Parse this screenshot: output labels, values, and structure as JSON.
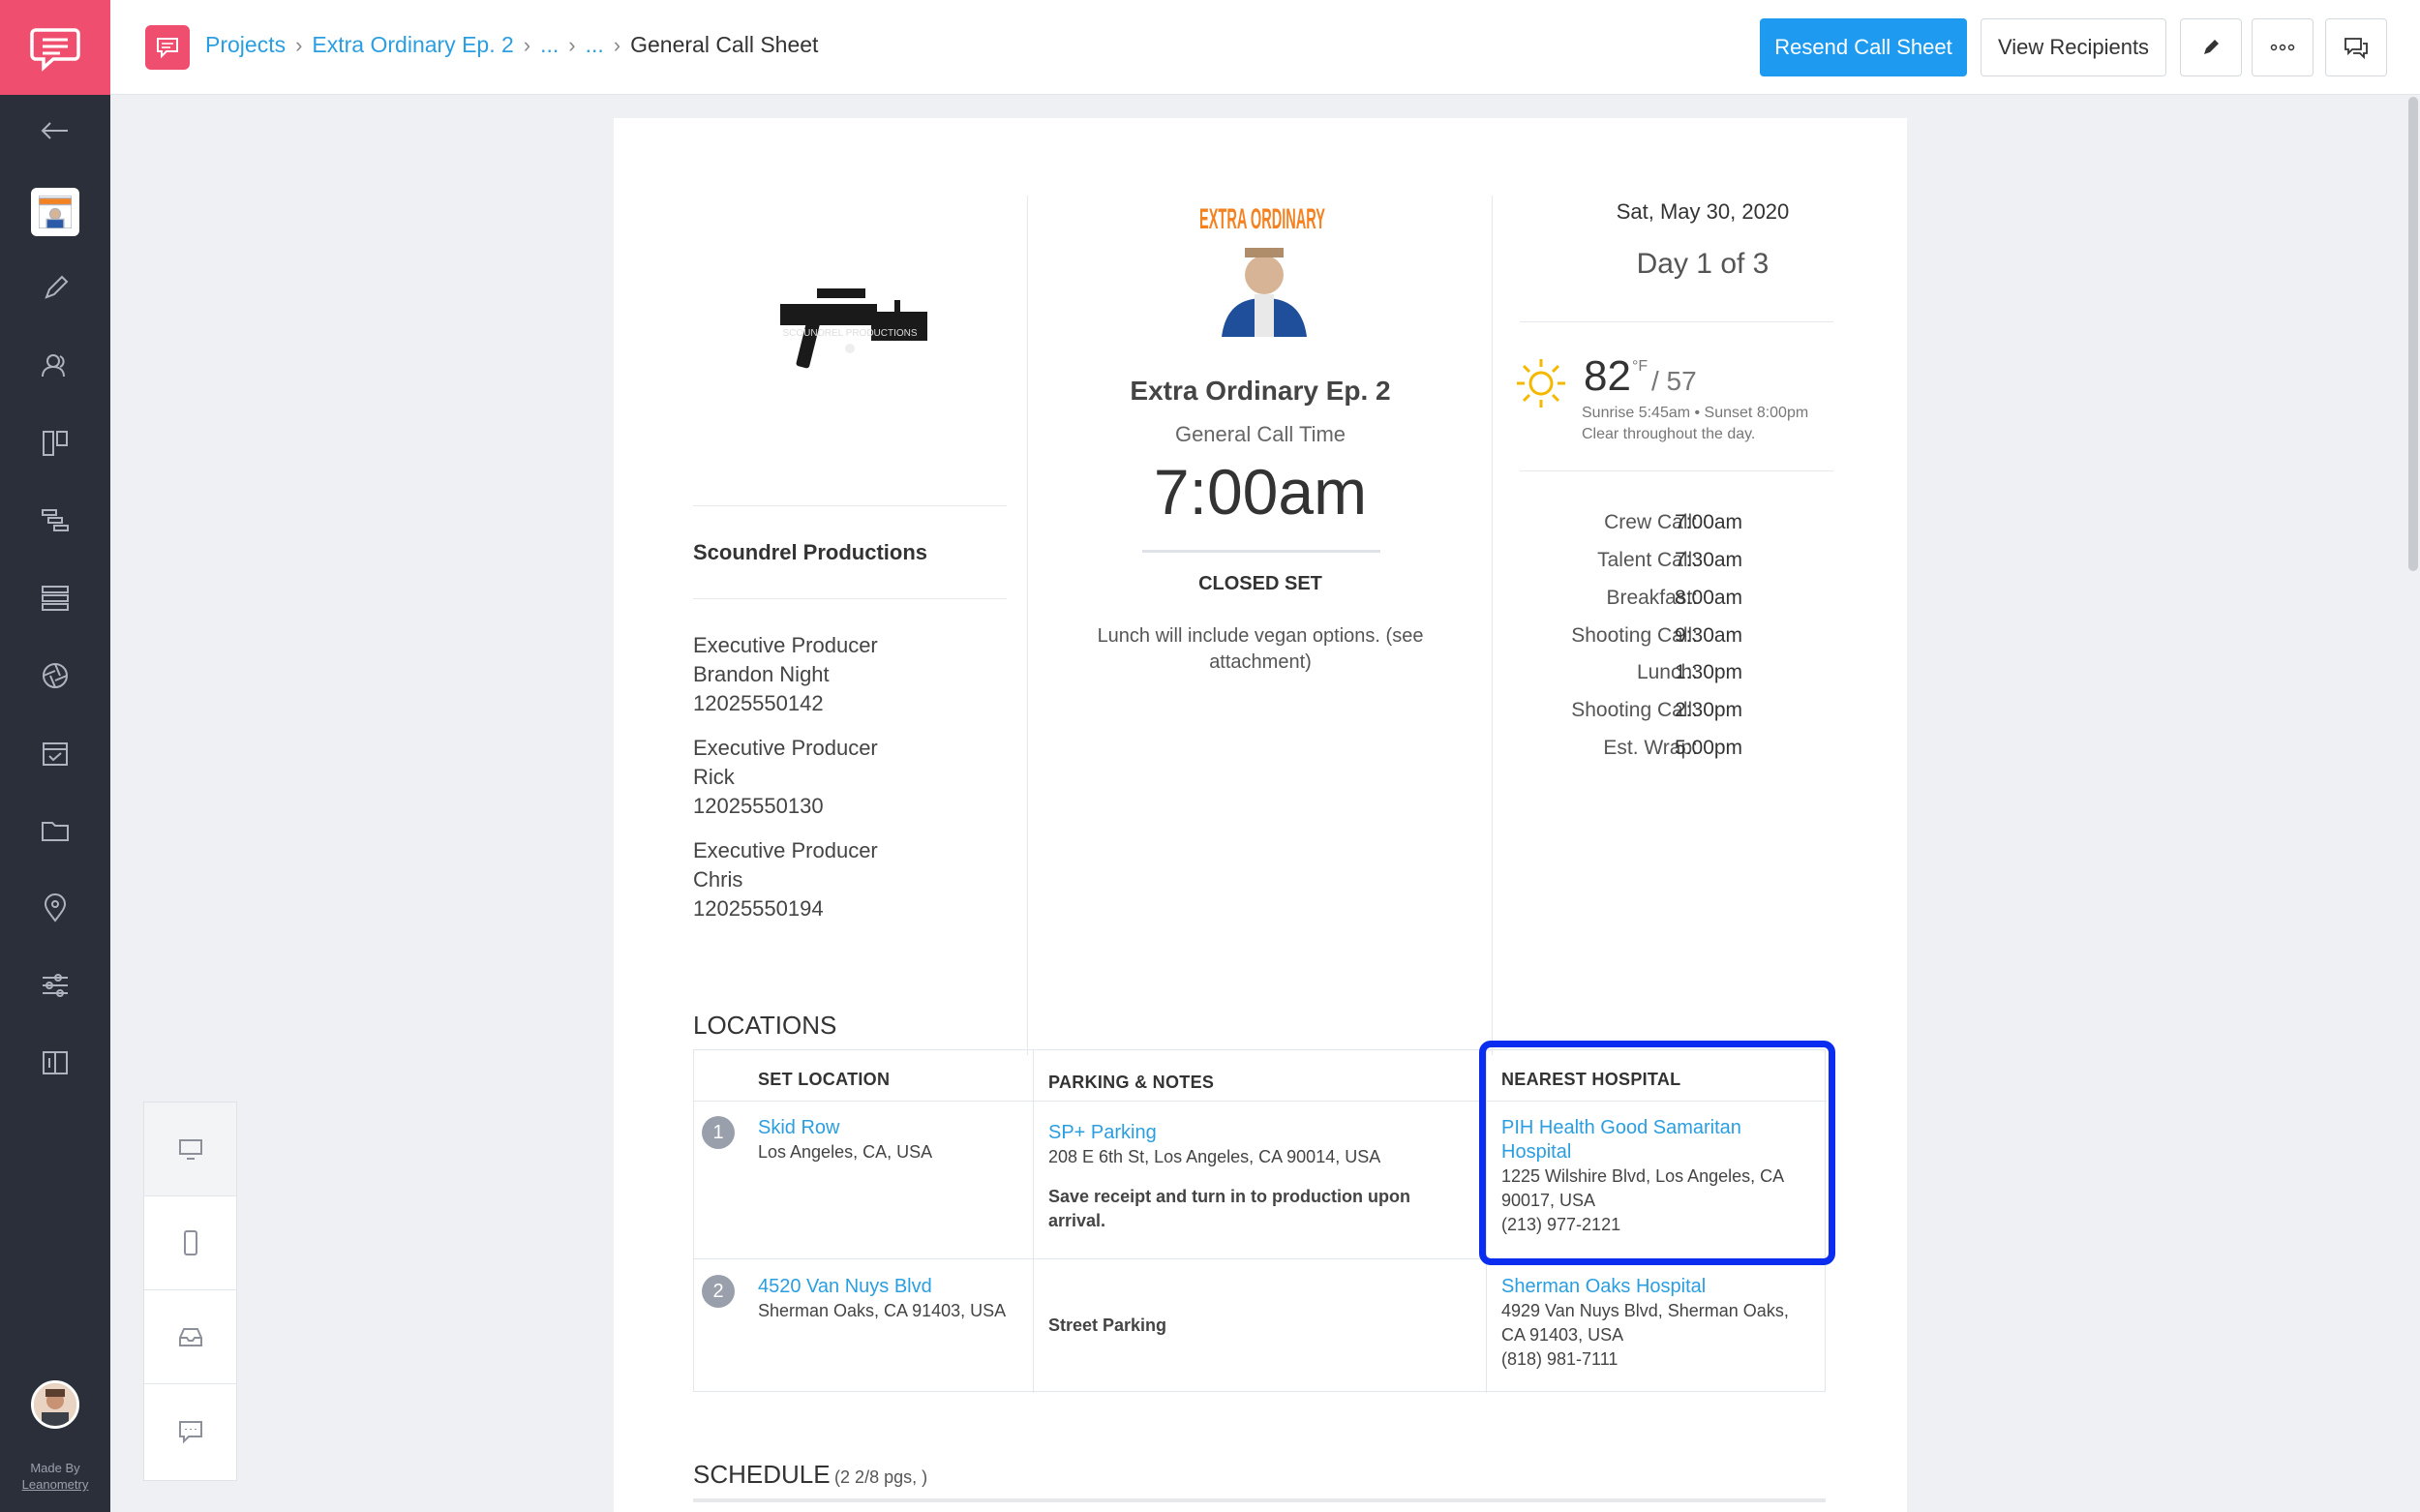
{
  "topbar": {
    "breadcrumb": [
      "Projects",
      "Extra Ordinary Ep. 2",
      "...",
      "...",
      "General Call Sheet"
    ],
    "resend_label": "Resend Call Sheet",
    "view_recipients_label": "View Recipients",
    "edit_icon": "pencil-icon",
    "more_icon": "ellipsis-icon",
    "comments_icon": "chat-bubbles-icon"
  },
  "sidebar": {
    "items": [
      "back-arrow-icon",
      "project-thumbnail",
      "pencil-icon",
      "people-icon",
      "board-icon",
      "gantt-icon",
      "stripboard-icon",
      "aperture-icon",
      "calendar-check-icon",
      "folder-icon",
      "location-pin-icon",
      "sliders-icon",
      "book-icon"
    ],
    "made_by": "Made By",
    "made_by_company": "Leanometry"
  },
  "device_panel": [
    "desktop-icon",
    "mobile-icon",
    "inbox-icon",
    "message-icon"
  ],
  "sheet": {
    "company": "Scoundrel Productions",
    "contacts": [
      {
        "role": "Executive Producer",
        "name": "Brandon Night",
        "phone": "12025550142"
      },
      {
        "role": "Executive Producer",
        "name": "Rick",
        "phone": "12025550130"
      },
      {
        "role": "Executive Producer",
        "name": "Chris",
        "phone": "12025550194"
      }
    ],
    "project_title": "Extra Ordinary Ep. 2",
    "general_call_label": "General Call Time",
    "general_call_time": "7:00am",
    "closed_set": "CLOSED SET",
    "notes": "Lunch will include vegan options. (see",
    "notes2": "attachment)",
    "poster_text": "EXTRA ORDINARY",
    "logo_text": "SCOUNDREL PRODUCTIONS",
    "date": "Sat, May 30, 2020",
    "day": "Day 1 of 3",
    "weather": {
      "high": "82",
      "unit": "°F",
      "low": "/ 57",
      "sun": "Sunrise 5:45am • Sunset 8:00pm",
      "desc": "Clear throughout the day."
    },
    "schedule": [
      {
        "label": "Crew Call:",
        "time": "7:00am"
      },
      {
        "label": "Talent Call:",
        "time": "7:30am"
      },
      {
        "label": "Breakfast:",
        "time": "8:00am"
      },
      {
        "label": "Shooting Call:",
        "time": "9:30am"
      },
      {
        "label": "Lunch:",
        "time": "1:30pm"
      },
      {
        "label": "Shooting Call:",
        "time": "2:30pm"
      },
      {
        "label": "Est. Wrap:",
        "time": "5:00pm"
      }
    ],
    "locations_heading": "LOCATIONS",
    "locations_headers": [
      "SET LOCATION",
      "PARKING & NOTES",
      "NEAREST HOSPITAL"
    ],
    "locations": [
      {
        "num": "1",
        "name": "Skid Row",
        "address": "Los Angeles, CA, USA",
        "parking_name": "SP+ Parking",
        "parking_address": "208 E 6th St, Los Angeles, CA 90014, USA",
        "parking_note1": "Save receipt and turn in to production upon",
        "parking_note2": "arrival.",
        "hospital_name1": "PIH Health Good Samaritan",
        "hospital_name2": "Hospital",
        "hospital_addr1": "1225 Wilshire Blvd, Los Angeles, CA",
        "hospital_addr2": "90017, USA",
        "hospital_phone": "(213) 977-2121"
      },
      {
        "num": "2",
        "name": "4520 Van Nuys Blvd",
        "address": "Sherman Oaks, CA 91403, USA",
        "parking_note1": "Street Parking",
        "hospital_name1": "Sherman Oaks Hospital",
        "hospital_addr1": "4929 Van Nuys Blvd, Sherman Oaks,",
        "hospital_addr2": "CA 91403, USA",
        "hospital_phone": "(818) 981-7111"
      }
    ],
    "schedule_heading": "SCHEDULE",
    "schedule_pages": "(2 2/8 pgs, )"
  },
  "colors": {
    "brand": "#f04e6e",
    "accent": "#1e9bf0",
    "sidebar": "#2b2f3a",
    "highlight": "#0a2df0"
  }
}
